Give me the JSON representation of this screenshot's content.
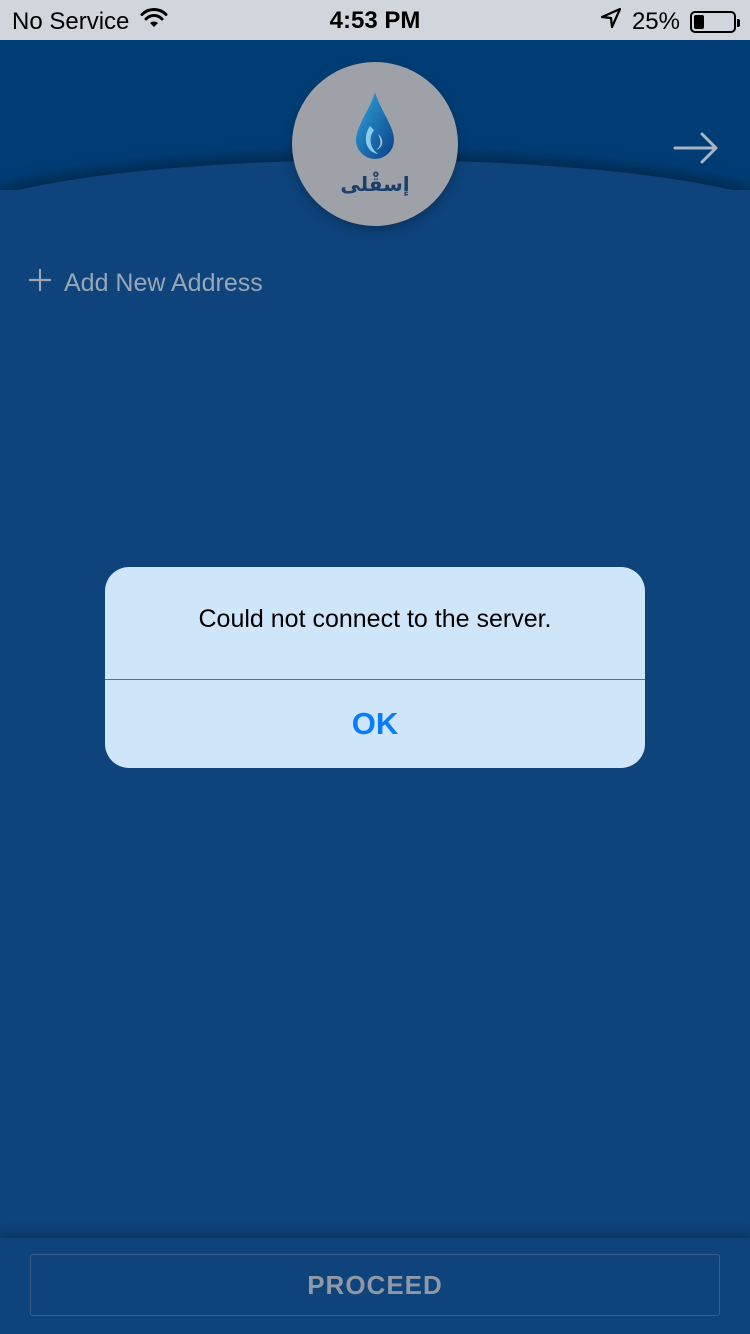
{
  "status_bar": {
    "carrier": "No Service",
    "time": "4:53 PM",
    "battery_percent": "25%",
    "battery_level": 0.25,
    "icons": [
      "wifi-icon",
      "location-arrow-icon",
      "battery-icon"
    ]
  },
  "header": {
    "logo_text": "إسقْلى",
    "next_icon": "arrow-right-icon"
  },
  "address": {
    "add_icon": "plus-icon",
    "add_label": "Add New Address"
  },
  "alert": {
    "message": "Could not connect to the server.",
    "ok_label": "OK"
  },
  "footer": {
    "proceed_label": "PROCEED"
  },
  "colors": {
    "background": "#0e437b",
    "header": "#003d75",
    "alert_bg": "#cfe5f9",
    "alert_action": "#0a7cfa"
  }
}
